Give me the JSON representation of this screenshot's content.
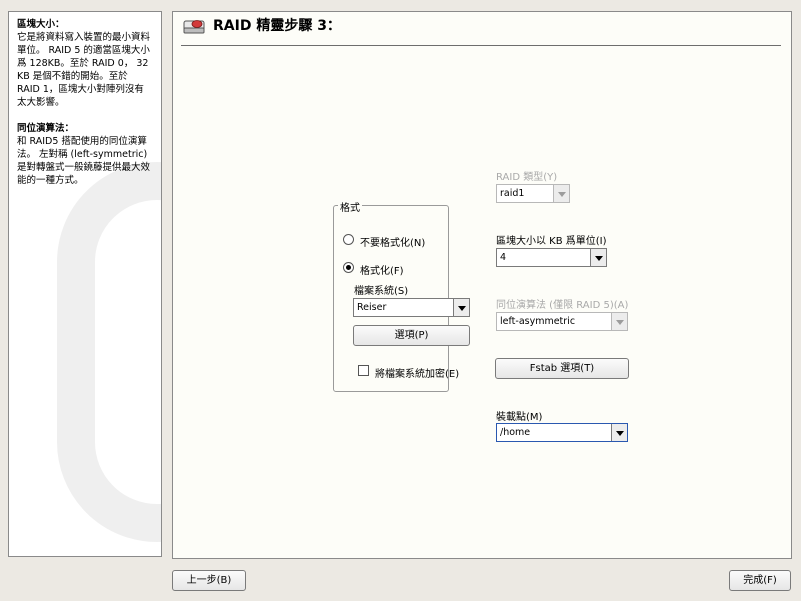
{
  "help": {
    "chunk_heading": "區塊大小：",
    "chunk_text": "它是將資料寫入裝置的最小資料單位。 RAID 5 的適當區塊大小爲 128KB。至於 RAID 0， 32 KB 是個不錯的開始。至於 RAID 1，區塊大小對陣列沒有太大影響。",
    "parity_heading": "同位演算法：",
    "parity_text": "和 RAID5 搭配使用的同位演算法。 左對稱 (left-symmetric) 是對轉盤式一般鐃藤提供最大效能的一種方式。"
  },
  "header": {
    "title": "RAID 精靈步驟 3：",
    "icon": "hard-disk-icon"
  },
  "format_group": {
    "legend": "格式",
    "no_format_label": "不要格式化(N)",
    "format_label": "格式化(F)",
    "filesystem_label": "檔案系統(S)",
    "filesystem_value": "Reiser",
    "options_button": "選項(P)",
    "encrypt_label": "將檔案系統加密(E)"
  },
  "raid_type": {
    "label": "RAID 類型(Y)",
    "value": "raid1"
  },
  "chunk_size": {
    "label": "區塊大小以 KB 爲單位(I)",
    "value": "4"
  },
  "parity": {
    "label": "同位演算法 (僅限 RAID 5)(A)",
    "value": "left-asymmetric"
  },
  "fstab_button": "Fstab 選項(T)",
  "mount": {
    "label": "裝載點(M)",
    "value": "/home"
  },
  "footer": {
    "back": "上一步(B)",
    "finish": "完成(F)"
  },
  "colors": {
    "accent_focus": "#2a58b0",
    "disabled_text": "#a9a9a9"
  }
}
